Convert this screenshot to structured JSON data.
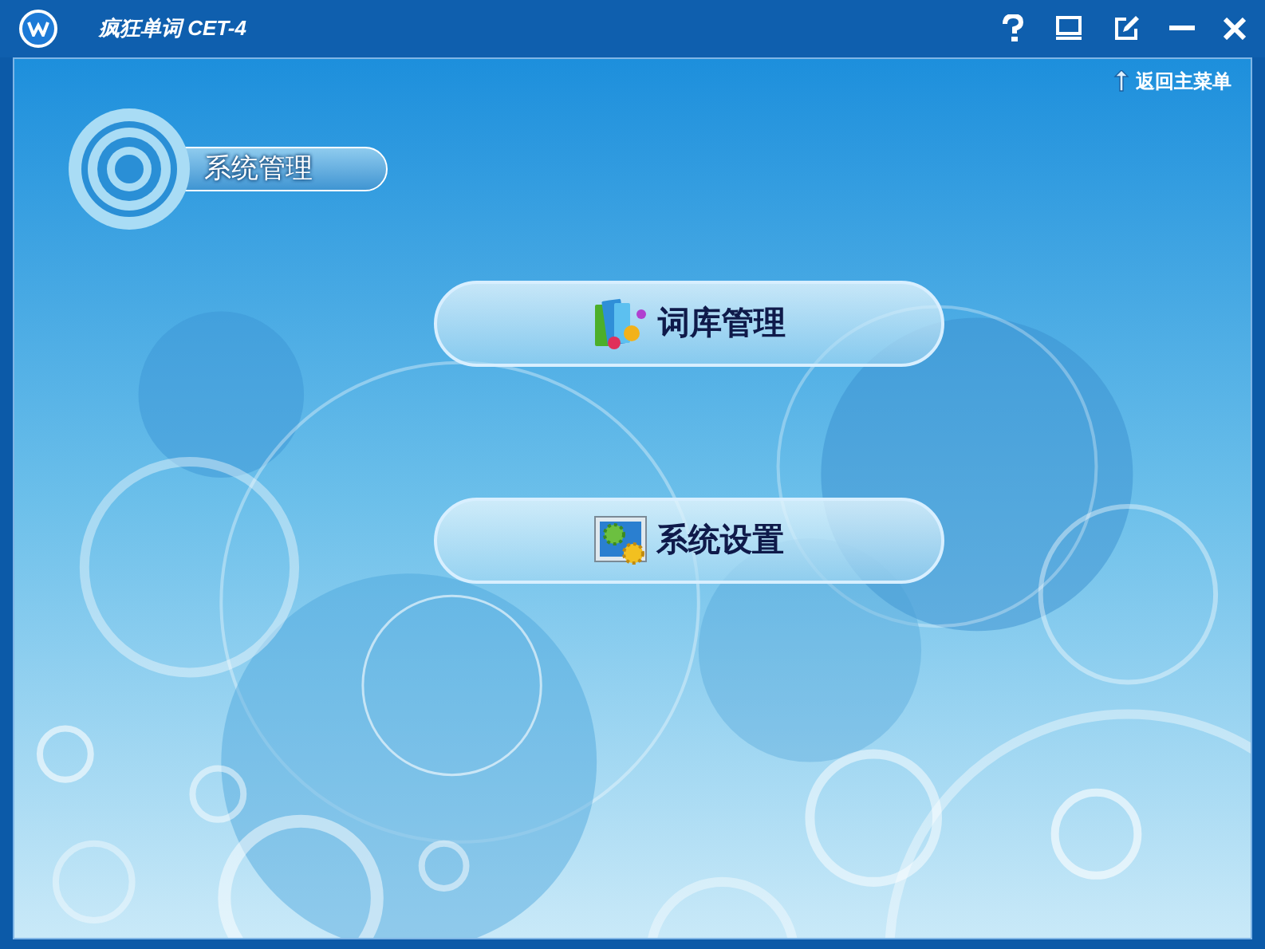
{
  "window": {
    "title": "疯狂单词 CET-4"
  },
  "back_link": "返回主菜单",
  "section_label": "系统管理",
  "menu_buttons": [
    {
      "label": "词库管理",
      "kind": "library"
    },
    {
      "label": "系统设置",
      "kind": "settings"
    }
  ]
}
